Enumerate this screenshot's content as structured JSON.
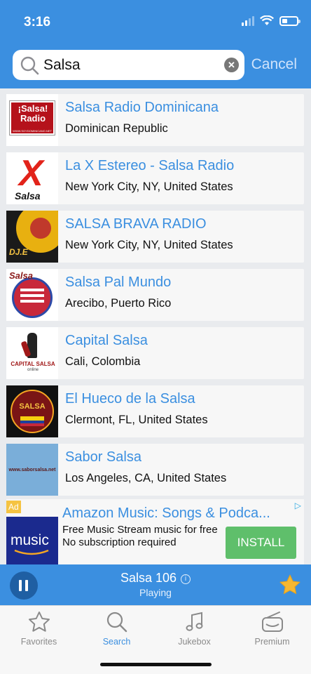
{
  "status": {
    "time": "3:16"
  },
  "search": {
    "value": "Salsa",
    "cancel_label": "Cancel"
  },
  "stations": [
    {
      "title": "Salsa Radio Dominicana",
      "location": "Dominican Republic",
      "logo_text": "¡Salsa! Radio",
      "logo_subtext": "WWW.SOYDOMINICANO.NET"
    },
    {
      "title": "La X Estereo - Salsa Radio",
      "location": "New York City, NY, United States",
      "logo_text": "Salsa"
    },
    {
      "title": "SALSA BRAVA RADIO",
      "location": "New York City, NY, United States",
      "logo_text": "DJ.E"
    },
    {
      "title": "Salsa Pal Mundo",
      "location": "Arecibo, Puerto Rico",
      "logo_text": "Salsa"
    },
    {
      "title": "Capital Salsa",
      "location": "Cali, Colombia",
      "logo_text": "CAPITAL SALSA",
      "logo_subtext": "online"
    },
    {
      "title": "El Hueco de la Salsa",
      "location": "Clermont, FL, United States",
      "logo_text": "SALSA"
    },
    {
      "title": "Sabor Salsa",
      "location": "Los Angeles, CA, United States",
      "logo_text": "www.saborsalsa.net"
    }
  ],
  "ad": {
    "badge": "Ad",
    "title": "Amazon Music: Songs & Podca...",
    "description": "Free Music Stream music for free No subscription required",
    "install_label": "INSTALL",
    "logo_text": "music"
  },
  "player": {
    "station": "Salsa 106",
    "status": "Playing"
  },
  "tabs": [
    {
      "label": "Favorites",
      "icon": "star-outline-icon",
      "active": false
    },
    {
      "label": "Search",
      "icon": "search-icon",
      "active": true
    },
    {
      "label": "Jukebox",
      "icon": "music-note-icon",
      "active": false
    },
    {
      "label": "Premium",
      "icon": "radio-icon",
      "active": false
    }
  ],
  "colors": {
    "accent": "#3b8fe0",
    "install": "#5fbf6b",
    "star": "#f5b731"
  }
}
